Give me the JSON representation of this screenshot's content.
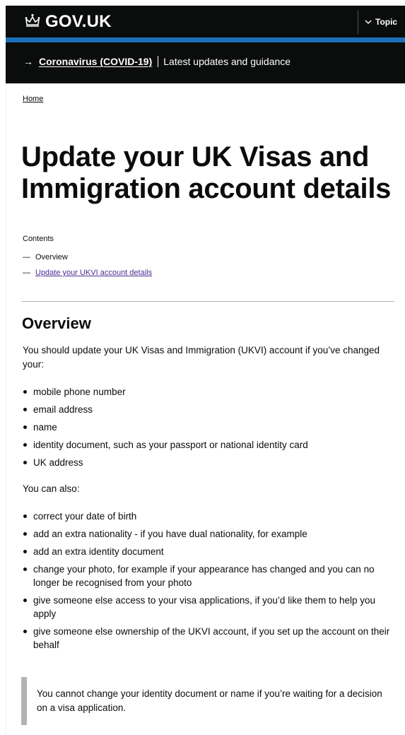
{
  "header": {
    "logo_text": "GOV.UK",
    "topics_label": "Topic"
  },
  "covid_banner": {
    "arrow": "→",
    "link_text": "Coronavirus (COVID-19)",
    "text": "Latest updates and guidance"
  },
  "breadcrumb": {
    "home": "Home"
  },
  "page": {
    "title": "Update your UK Visas and Immigration account details"
  },
  "contents": {
    "label": "Contents",
    "dash": "—",
    "items": [
      {
        "label": "Overview"
      },
      {
        "label": "Update your UKVI account details"
      }
    ]
  },
  "overview": {
    "heading": "Overview",
    "intro": "You should update your UK Visas and Immigration (UKVI) account if you’ve changed your:",
    "changed_items": [
      "mobile phone number",
      "email address",
      "name",
      "identity document, such as your passport or national identity card",
      "UK address"
    ],
    "also_label": "You can also:",
    "also_items": [
      "correct your date of birth",
      "add an extra nationality - if you have dual nationality, for example",
      "add an extra identity document",
      "change your photo, for example if your appearance has changed and you can no longer be recognised from your photo",
      "give someone else access to your visa applications, if you’d like them to help you apply",
      "give someone else ownership of the UKVI account, if you set up the account on their behalf"
    ],
    "inset_text": "You cannot change your identity document or name if you’re waiting for a decision on a visa application."
  },
  "colors": {
    "header_bg": "#0b0c0c",
    "header_accent": "#1d70b8",
    "visited_link": "#4c2c92",
    "text": "#0b0c0c",
    "border": "#b1b4b6"
  }
}
